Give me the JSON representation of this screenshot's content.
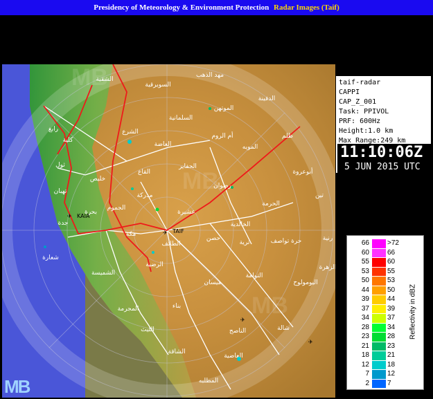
{
  "header": {
    "title": "Presidency of Meteorology & Environment Protection",
    "subtitle": "Radar Images (Taif)"
  },
  "info_panel": {
    "lines": [
      "taif-radar",
      "CAPPI",
      "CAP_Z_001",
      "Task: PPIVOL",
      "PRF: 600Hz",
      "Height:1.0 km",
      "Max Range:249 km"
    ],
    "time": "11:10:06Z",
    "date": "5 JUN 2015 UTC"
  },
  "legend": {
    "title": "Reflectivity in dBZ",
    "rows": [
      {
        "lo": "66",
        "hi": ">72",
        "color": "#ff00ff"
      },
      {
        "lo": "60",
        "hi": "66",
        "color": "#ff33ff"
      },
      {
        "lo": "55",
        "hi": "60",
        "color": "#ff0000"
      },
      {
        "lo": "53",
        "hi": "55",
        "color": "#ff3300"
      },
      {
        "lo": "50",
        "hi": "53",
        "color": "#ff7700"
      },
      {
        "lo": "44",
        "hi": "50",
        "color": "#ffa000"
      },
      {
        "lo": "39",
        "hi": "44",
        "color": "#ffcc00"
      },
      {
        "lo": "37",
        "hi": "39",
        "color": "#ffee00"
      },
      {
        "lo": "34",
        "hi": "37",
        "color": "#ccff00"
      },
      {
        "lo": "28",
        "hi": "34",
        "color": "#00ff33"
      },
      {
        "lo": "23",
        "hi": "28",
        "color": "#00dd33"
      },
      {
        "lo": "21",
        "hi": "23",
        "color": "#00bb66"
      },
      {
        "lo": "18",
        "hi": "21",
        "color": "#00cc99"
      },
      {
        "lo": "12",
        "hi": "18",
        "color": "#00cccc"
      },
      {
        "lo": "7",
        "hi": "12",
        "color": "#0099cc"
      },
      {
        "lo": "2",
        "hi": "7",
        "color": "#0066ff"
      }
    ]
  },
  "map": {
    "airports": [
      "KAIA",
      "TAIF"
    ],
    "places": [
      "مهد الذهب",
      "الشفية",
      "السويرقية",
      "الدفينة",
      "الموتهن",
      "السلمانية",
      "الشرع",
      "أم الروم",
      "خليص",
      "المويه",
      "ظلم",
      "رابغ",
      "كلية",
      "العاضة",
      "الحفاير",
      "عشيرة",
      "ثول",
      "القاع",
      "أبوعروة",
      "مدركة",
      "رضوان",
      "تين",
      "تهبان",
      "الجموم",
      "الحرمة",
      "بحرة",
      "جدة",
      "حصن",
      "الخالدية",
      "مكة",
      "الطائف",
      "رنية",
      "ترية",
      "حرة تواصف",
      "شعارة",
      "الزهرة",
      "الرضية",
      "الشميسة",
      "التوامة",
      "ميسان",
      "اليومولوح",
      "بناء",
      "المجرمة",
      "الليث",
      "الناصج",
      "شالة",
      "الشاقة",
      "العاضية",
      "المطلبه"
    ],
    "watermark": "MB"
  }
}
